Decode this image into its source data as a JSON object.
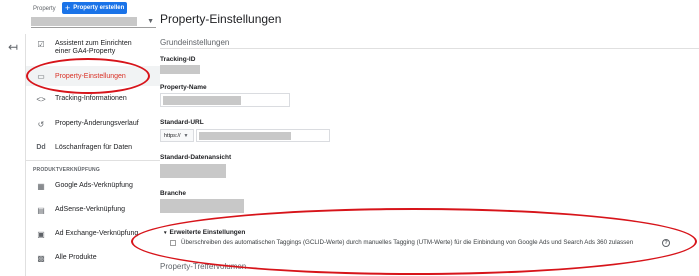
{
  "sidebar": {
    "property_label": "Property",
    "create_button": "Property erstellen",
    "items": [
      {
        "label": "Assistent zum Einrichten einer GA4-Property",
        "icon": "checkbox-icon"
      },
      {
        "label": "Property-Einstellungen",
        "icon": "property-settings-icon"
      },
      {
        "label": "Tracking-Informationen",
        "icon": "code-icon"
      },
      {
        "label": "Property-Änderungsverlauf",
        "icon": "history-icon"
      },
      {
        "label": "Löschanfragen für Daten",
        "icon": "dd-icon"
      }
    ],
    "section_label": "PRODUKTVERKNÜPFUNG",
    "links": [
      {
        "label": "Google Ads-Verknüpfung",
        "icon": "ads-link-icon"
      },
      {
        "label": "AdSense-Verknüpfung",
        "icon": "adsense-icon"
      },
      {
        "label": "Ad Exchange-Verknüpfung",
        "icon": "ad-exchange-icon"
      },
      {
        "label": "Alle Produkte",
        "icon": "all-products-icon"
      }
    ]
  },
  "main": {
    "title": "Property-Einstellungen",
    "section_basic": "Grundeinstellungen",
    "fields": {
      "tracking_id": "Tracking-ID",
      "property_name": "Property-Name",
      "default_url": "Standard-URL",
      "url_prefix": "https://",
      "default_view": "Standard-Datenansicht",
      "industry": "Branche"
    },
    "advanced_title": "Erweiterte Einstellungen",
    "advanced_checkbox_label": "Überschreiben des automatischen Taggings (GCLID-Werte) durch manuelles Tagging (UTM-Werte) für die Einbindung von Google Ads und Search Ads 360 zulassen",
    "advanced_checkbox_checked": false,
    "section_hits": "Property-Treffervolumen"
  },
  "colors": {
    "accent": "#1a73e8",
    "annotation": "#d7141a",
    "active_text": "#d93025"
  }
}
